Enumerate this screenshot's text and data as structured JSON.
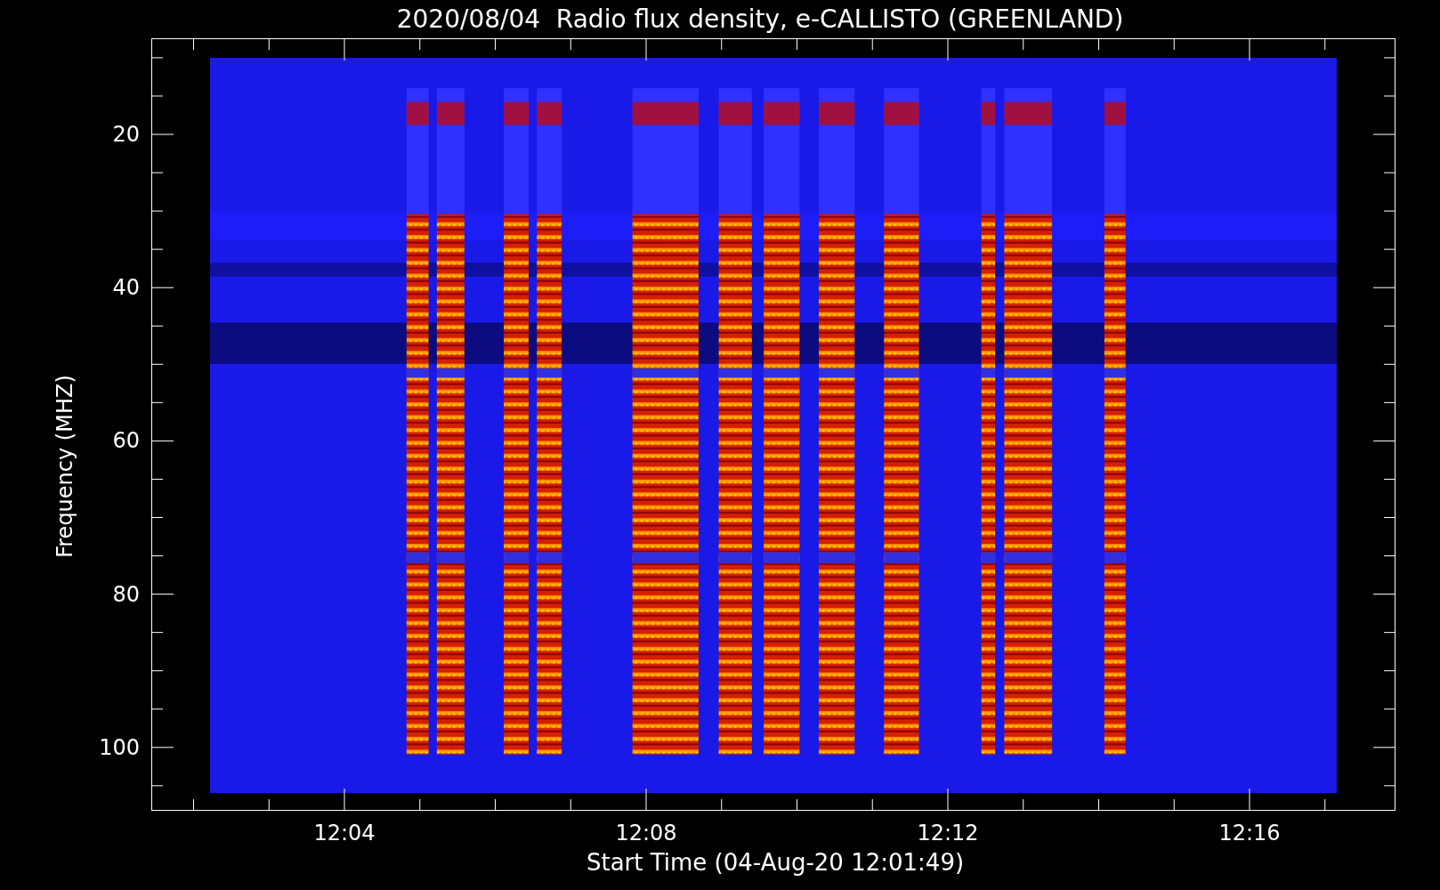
{
  "title": "2020/08/04  Radio flux density, e-CALLISTO (GREENLAND)",
  "y_axis": {
    "label": "Frequency (MHZ)",
    "ticks": [
      "20",
      "40",
      "60",
      "80",
      "100"
    ]
  },
  "x_axis": {
    "label": "Start Time (04-Aug-20 12:01:49)",
    "ticks": [
      "12:04",
      "12:08",
      "12:12",
      "12:16"
    ]
  }
}
